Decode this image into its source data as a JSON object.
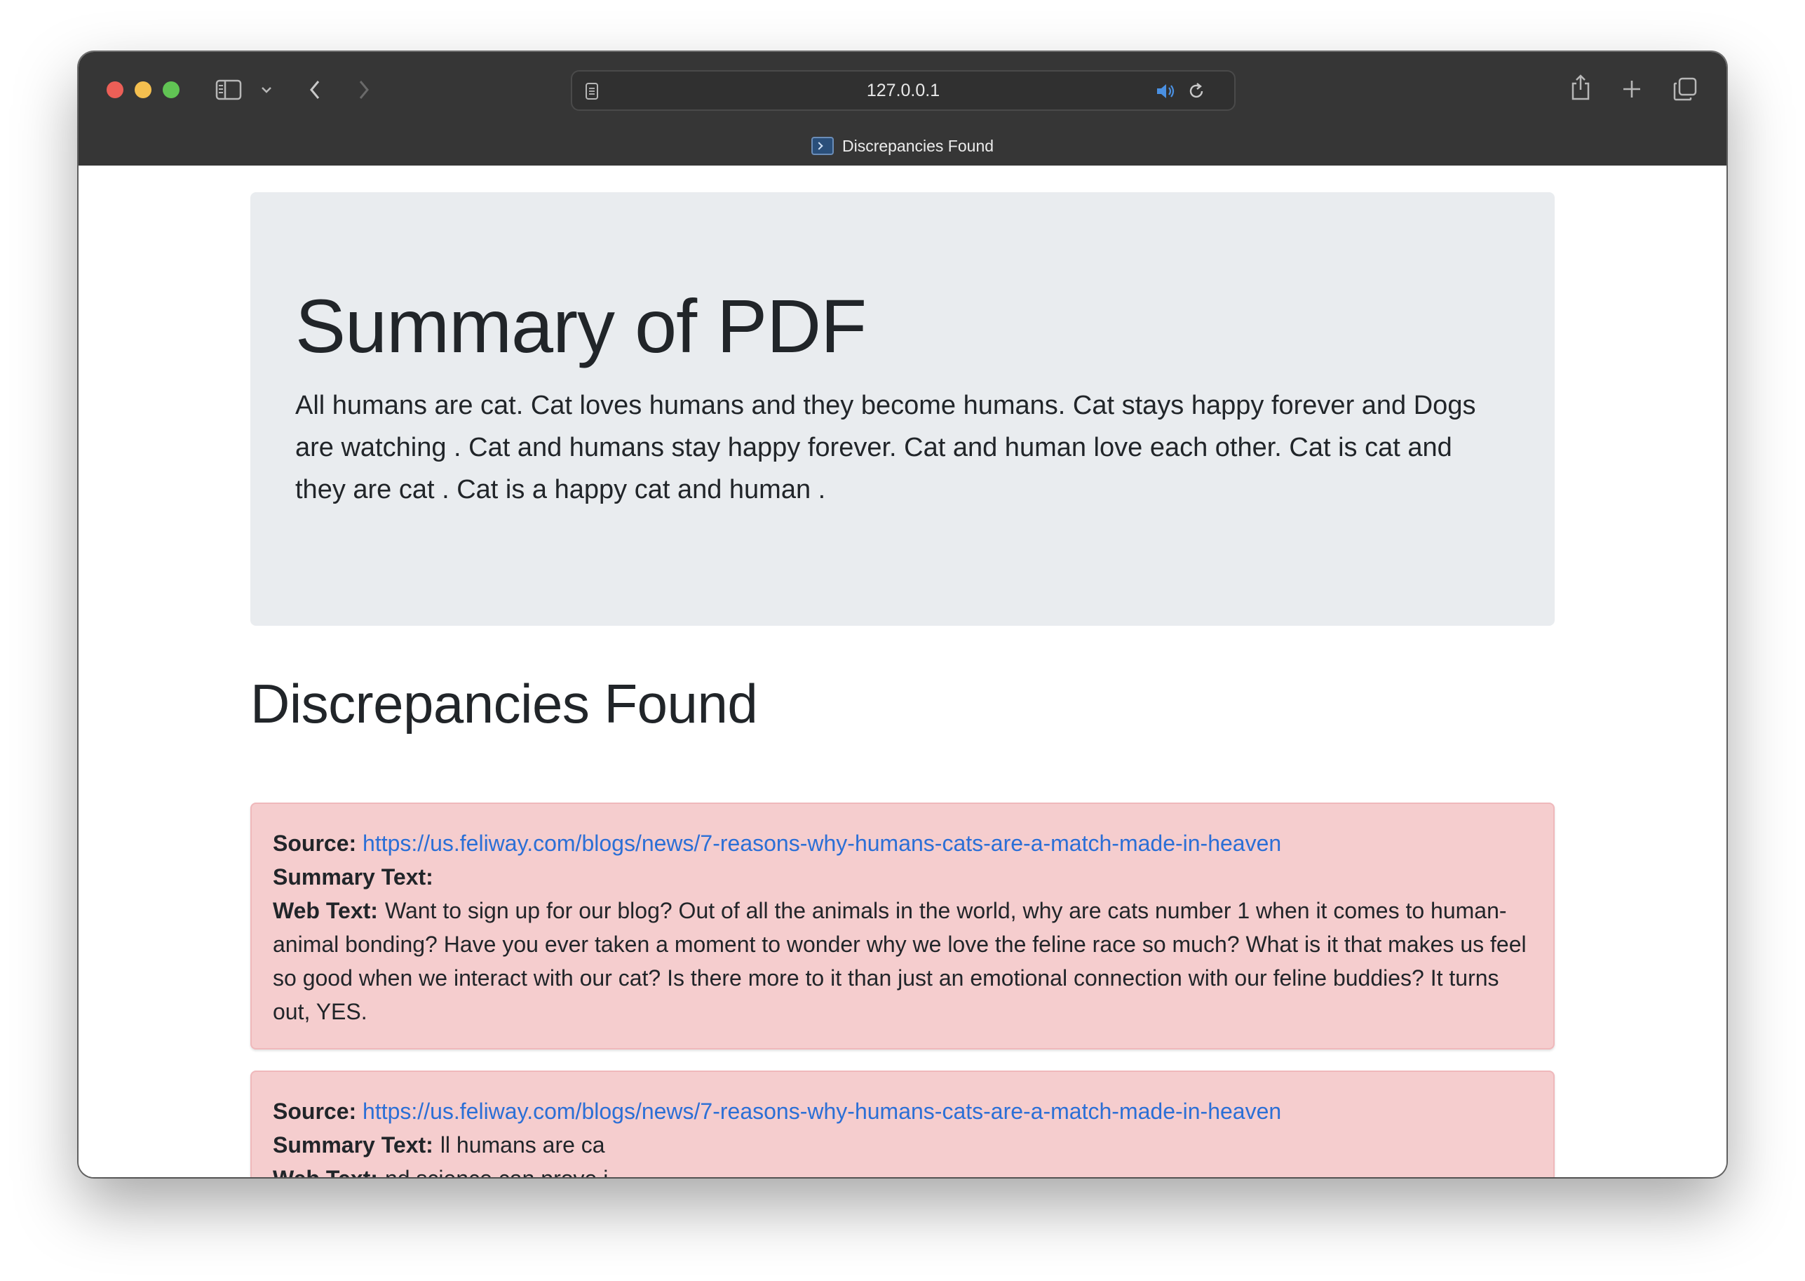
{
  "browser": {
    "address": "127.0.0.1",
    "tab_title": "Discrepancies Found"
  },
  "summary": {
    "title": "Summary of PDF",
    "text": "All humans are cat. Cat loves humans and they become humans. Cat stays happy forever and Dogs are watching . Cat and humans stay happy forever. Cat and human love each other. Cat is cat and they are cat . Cat is a happy cat and human ."
  },
  "discrepancies": {
    "heading": "Discrepancies Found",
    "source_label": "Source:",
    "summary_label": "Summary Text:",
    "web_label": "Web Text:",
    "items": [
      {
        "source_url": "https://us.feliway.com/blogs/news/7-reasons-why-humans-cats-are-a-match-made-in-heaven",
        "summary_text": "",
        "web_text": "Want to sign up for our blog? Out of all the animals in the world, why are cats number 1 when it comes to human-animal bonding? Have you ever taken a moment to wonder why we love the feline race so much? What is it that makes us feel so good when we interact with our cat? Is there more to it than just an emotional connection with our feline buddies? It turns out, YES."
      },
      {
        "source_url": "https://us.feliway.com/blogs/news/7-reasons-why-humans-cats-are-a-match-made-in-heaven",
        "summary_text": "ll humans are ca",
        "web_text": "nd science can prove i"
      }
    ]
  },
  "colors": {
    "titlebar": "#363636",
    "jumbotron_bg": "#e9ecef",
    "alert_bg": "#f5cdce",
    "link": "#2b6fd6"
  }
}
